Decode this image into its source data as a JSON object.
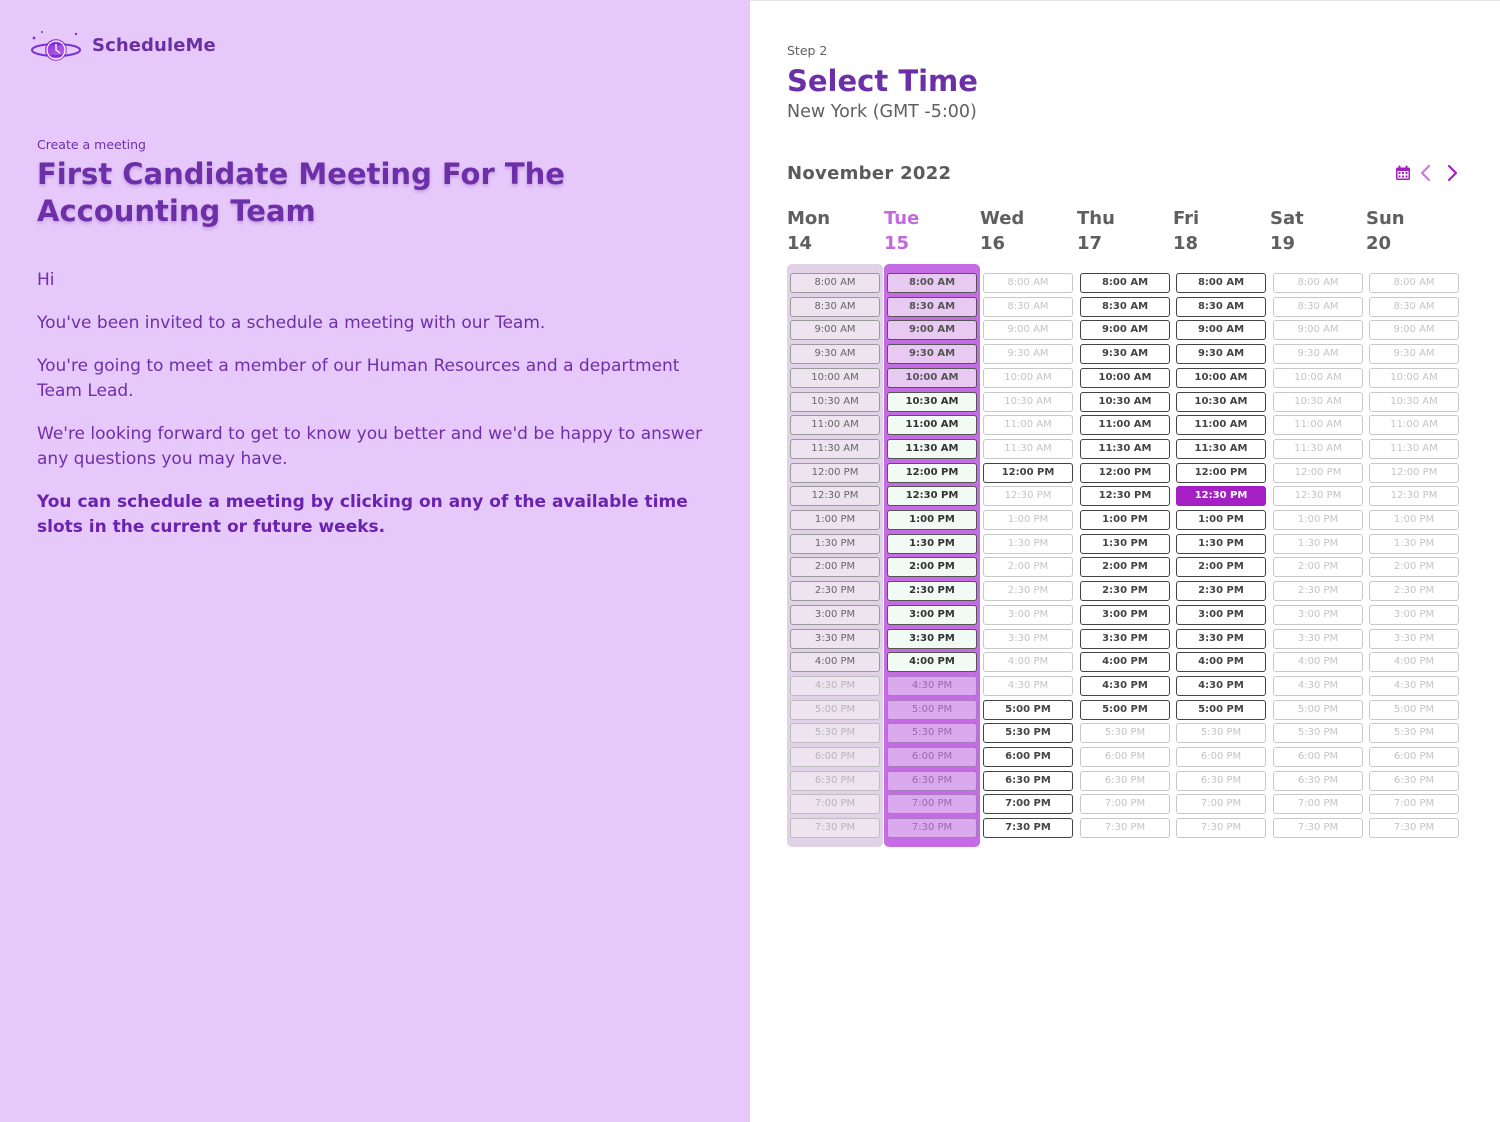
{
  "app": {
    "name": "ScheduleMe"
  },
  "meeting": {
    "eyebrow": "Create a meeting",
    "title": "First Candidate Meeting For The Accounting Team",
    "messages": [
      "Hi",
      "You've been invited to a schedule a meeting with our Team.",
      "You're going to meet a member of our Human Resources and a department Team Lead.",
      "We're looking forward to get to know you better and we'd be happy to answer any questions you may have.",
      "You can schedule a meeting by clicking on any of the available time slots in the current or future weeks."
    ]
  },
  "picker": {
    "step": "Step 2",
    "title": "Select Time",
    "timezone": "New York (GMT -5:00)",
    "month": "November 2022",
    "icons": {
      "calendar": "calendar-icon",
      "prev": "chevron-left-icon",
      "next": "chevron-right-icon"
    },
    "colors": {
      "accent": "#a520c4",
      "brand": "#6c2fa7",
      "today": "#c36ad9"
    },
    "days": [
      {
        "name": "Mon",
        "date": "14"
      },
      {
        "name": "Tue",
        "date": "15",
        "today": true
      },
      {
        "name": "Wed",
        "date": "16"
      },
      {
        "name": "Thu",
        "date": "17"
      },
      {
        "name": "Fri",
        "date": "18"
      },
      {
        "name": "Sat",
        "date": "19"
      },
      {
        "name": "Sun",
        "date": "20"
      }
    ],
    "times": [
      "8:00 AM",
      "8:30 AM",
      "9:00 AM",
      "9:30 AM",
      "10:00 AM",
      "10:30 AM",
      "11:00 AM",
      "11:30 AM",
      "12:00 PM",
      "12:30 PM",
      "1:00 PM",
      "1:30 PM",
      "2:00 PM",
      "2:30 PM",
      "3:00 PM",
      "3:30 PM",
      "4:00 PM",
      "4:30 PM",
      "5:00 PM",
      "5:30 PM",
      "6:00 PM",
      "6:30 PM",
      "7:00 PM",
      "7:30 PM"
    ],
    "selected": {
      "day": "Fri",
      "time": "12:30 PM"
    }
  }
}
